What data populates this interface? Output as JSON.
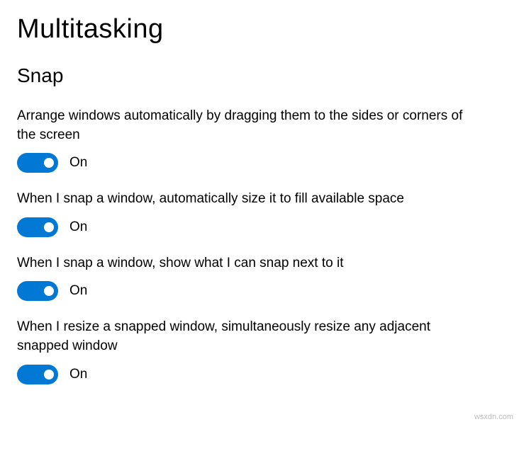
{
  "page": {
    "title": "Multitasking"
  },
  "section": {
    "title": "Snap"
  },
  "settings": [
    {
      "label": "Arrange windows automatically by dragging them to the sides or corners of the screen",
      "state": "On",
      "on": true
    },
    {
      "label": "When I snap a window, automatically size it to fill available space",
      "state": "On",
      "on": true
    },
    {
      "label": "When I snap a window, show what I can snap next to it",
      "state": "On",
      "on": true
    },
    {
      "label": "When I resize a snapped window, simultaneously resize any adjacent snapped window",
      "state": "On",
      "on": true
    }
  ],
  "watermark": "wsxdn.com"
}
